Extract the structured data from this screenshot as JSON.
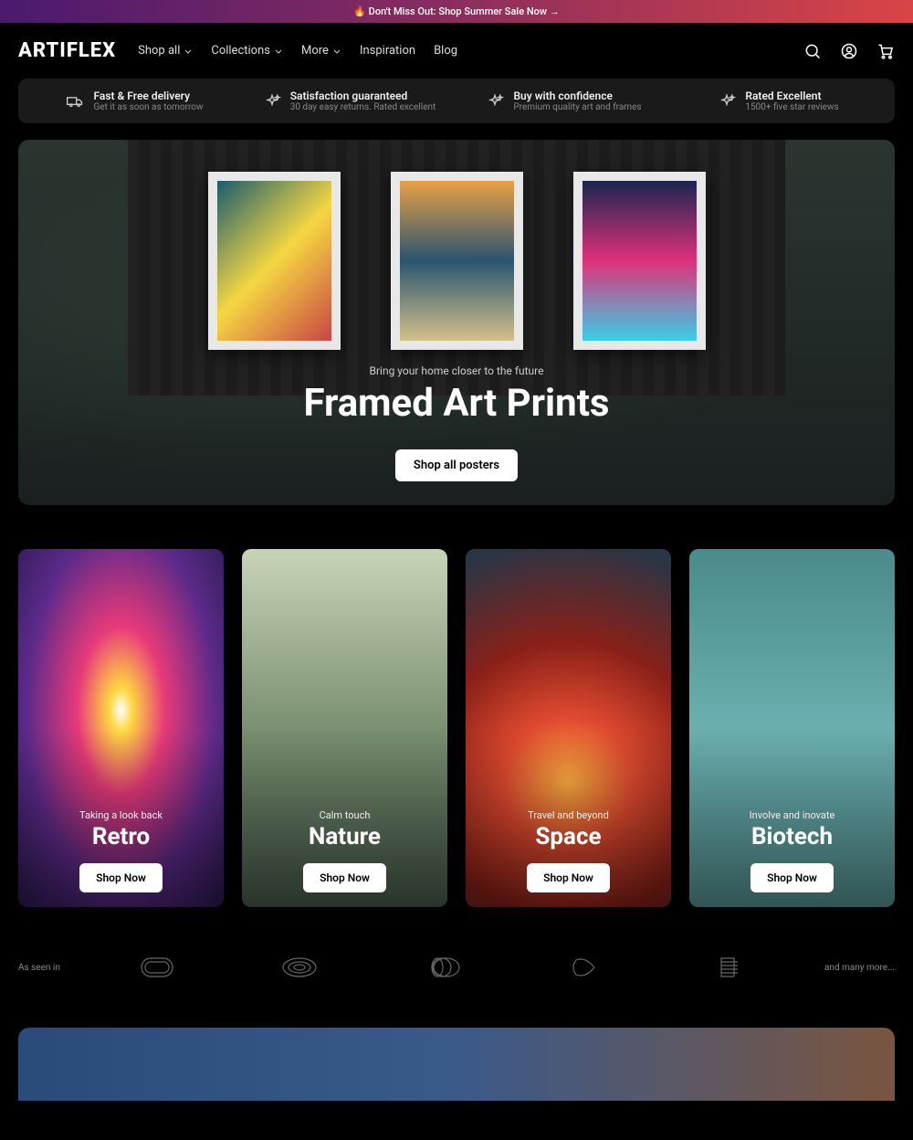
{
  "announcement": "🔥 Don't Miss Out: Shop Summer Sale Now →",
  "logo": "ARTIFLEX",
  "nav": {
    "shop_all": "Shop all",
    "collections": "Collections",
    "more": "More",
    "inspiration": "Inspiration",
    "blog": "Blog"
  },
  "features": [
    {
      "title": "Fast & Free delivery",
      "sub": "Get it as soon as tomorrow"
    },
    {
      "title": "Satisfaction guaranteed",
      "sub": "30 day easy returns. Rated excellent"
    },
    {
      "title": "Buy with confidence",
      "sub": "Premium quality art and frames"
    },
    {
      "title": "Rated Excellent",
      "sub": "1500+ five star reviews"
    }
  ],
  "hero": {
    "kicker": "Bring your home closer to the future",
    "title": "Framed Art Prints",
    "cta": "Shop all posters"
  },
  "cards": [
    {
      "kicker": "Taking a look back",
      "title": "Retro",
      "cta": "Shop Now"
    },
    {
      "kicker": "Calm touch",
      "title": "Nature",
      "cta": "Shop Now"
    },
    {
      "kicker": "Travel and beyond",
      "title": "Space",
      "cta": "Shop Now"
    },
    {
      "kicker": "Involve and inovate",
      "title": "Biotech",
      "cta": "Shop Now"
    }
  ],
  "seen": {
    "label": "As seen in",
    "more": "and many more..."
  }
}
